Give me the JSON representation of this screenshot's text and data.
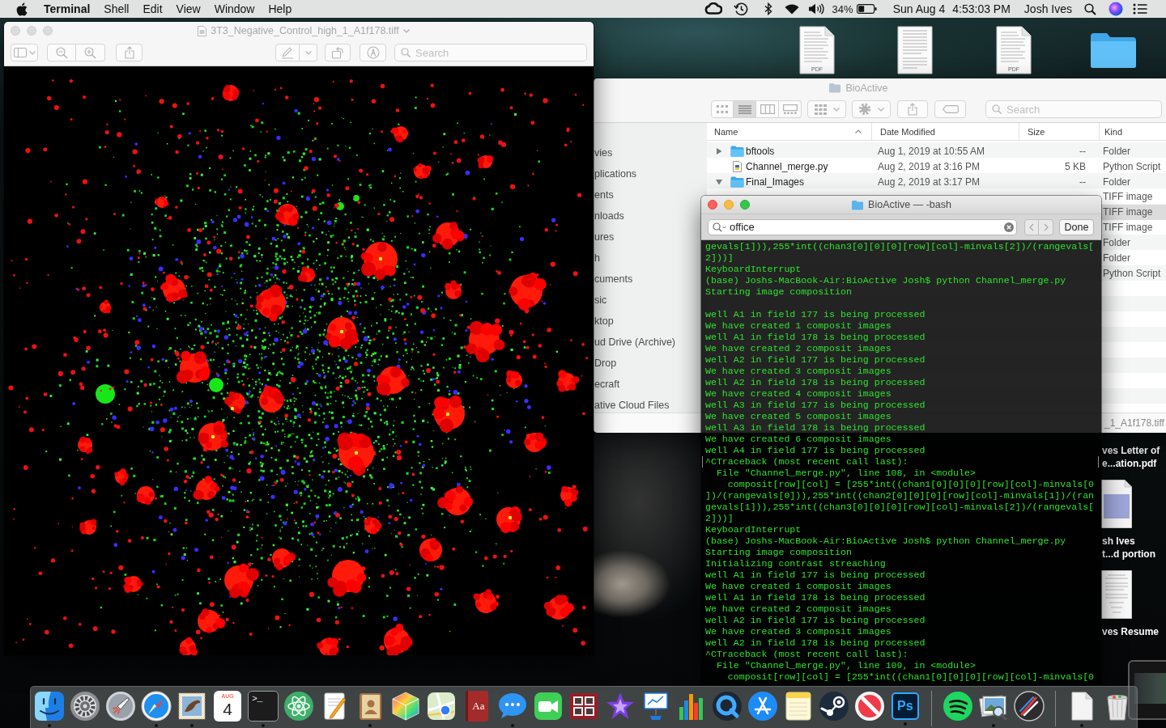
{
  "menu_bar": {
    "app_name": "Terminal",
    "menus": [
      "Shell",
      "Edit",
      "View",
      "Window",
      "Help"
    ],
    "battery": "34%",
    "date": "Sun Aug 4",
    "time": "4:53:03 PM",
    "user": "Josh Ives"
  },
  "desktop_icons": [
    {
      "kind": "pdf",
      "badge": "PDF"
    },
    {
      "kind": "document"
    },
    {
      "kind": "pdf",
      "badge": "PDF"
    },
    {
      "kind": "folder"
    }
  ],
  "preview_window": {
    "active": false,
    "title": "3T3_Negative_Control_high_1_A1f178.tiff",
    "search": {
      "placeholder": "Search"
    }
  },
  "finder_window": {
    "active": false,
    "title": "BioActive",
    "view_modes": [
      {
        "kind": "icons",
        "selected": false
      },
      {
        "kind": "list",
        "selected": true
      },
      {
        "kind": "columns",
        "selected": false
      },
      {
        "kind": "gallery",
        "selected": false
      }
    ],
    "search": {
      "placeholder": "Search"
    },
    "sidebar": {
      "items": [
        "vies",
        "plications",
        "ents",
        "nloads",
        "ures",
        "h",
        "cuments",
        "sic",
        "ktop",
        "ud Drive (Archive)",
        "Drop",
        "ecraft",
        "ative Cloud Files"
      ]
    },
    "columns": [
      {
        "label": "Name",
        "sorted": true
      },
      {
        "label": "Date Modified",
        "sorted": false
      },
      {
        "label": "Size",
        "sorted": false
      },
      {
        "label": "Kind",
        "sorted": false
      }
    ],
    "rows": [
      {
        "kind": "folder",
        "expanded": false,
        "name": "bftools",
        "date_modified": "Aug 1, 2019 at 10:55 AM",
        "size": "--",
        "kind_text": "Folder",
        "selected": false
      },
      {
        "kind": "script",
        "name": "Channel_merge.py",
        "date_modified": "Aug 2, 2019 at 3:16 PM",
        "size": "5 KB",
        "kind_text": "Python Script",
        "selected": false
      },
      {
        "kind": "folder",
        "expanded": true,
        "name": "Final_Images",
        "date_modified": "Aug 2, 2019 at 3:17 PM",
        "size": "--",
        "kind_text": "Folder",
        "selected": false
      },
      {
        "kind": "partial",
        "kind_text": "TIFF image",
        "selected": false
      },
      {
        "kind": "partial",
        "kind_text": "TIFF image",
        "selected": true
      },
      {
        "kind": "partial",
        "kind_text": "TIFF image",
        "selected": false
      },
      {
        "kind": "partial",
        "kind_text": "Folder",
        "selected": false
      },
      {
        "kind": "partial",
        "kind_text": "Folder",
        "selected": false
      },
      {
        "kind": "partial",
        "kind_text": "Python Script",
        "selected": false
      }
    ],
    "path_bar": "_1_A1f178.tiff"
  },
  "terminal_window": {
    "active": true,
    "title": "BioActive — -bash",
    "find_field": {
      "value": "office"
    },
    "done_label": "Done",
    "blocks": [
      {
        "lines": [
          {
            "text": "gevals[1])),255*int((chan3[0][0][0][row][col]-minvals[2])/(rangevals[",
            "marked": false
          },
          {
            "text": "2]))]",
            "marked": false
          },
          {
            "text": "KeyboardInterrupt",
            "marked": false
          },
          {
            "text": "(base) Joshs-MacBook-Air:BioActive Josh$ python Channel_merge.py",
            "marked": false
          },
          {
            "text": "Starting image composition",
            "marked": false
          }
        ]
      },
      {
        "lines": [
          {
            "text": "well A1 in field 177 is being processed",
            "marked": false
          },
          {
            "text": "We have created 1 composit images",
            "marked": false
          },
          {
            "text": "well A1 in field 178 is being processed",
            "marked": false
          },
          {
            "text": "We have created 2 composit images",
            "marked": false
          },
          {
            "text": "well A2 in field 177 is being processed",
            "marked": false
          },
          {
            "text": "We have created 3 composit images",
            "marked": false
          },
          {
            "text": "well A2 in field 178 is being processed",
            "marked": false
          },
          {
            "text": "We have created 4 composit images",
            "marked": false
          },
          {
            "text": "well A3 in field 177 is being processed",
            "marked": false
          },
          {
            "text": "We have created 5 composit images",
            "marked": false
          },
          {
            "text": "well A3 in field 178 is being processed",
            "marked": false
          },
          {
            "text": "We have created 6 composit images",
            "marked": false
          },
          {
            "text": "well A4 in field 177 is being processed",
            "marked": false
          },
          {
            "text": "^CTraceback (most recent call last):",
            "marked": true
          },
          {
            "text": "  File \"Channel_merge.py\", line 108, in <module>",
            "marked": false
          },
          {
            "text": "    composit[row][col] = [255*int((chan1[0][0][0][row][col]-minvals[0",
            "marked": false
          },
          {
            "text": "])/(rangevals[0])),255*int((chan2[0][0][0][row][col]-minvals[1])/(ran",
            "marked": false
          },
          {
            "text": "gevals[1])),255*int((chan3[0][0][0][row][col]-minvals[2])/(rangevals[",
            "marked": false
          },
          {
            "text": "2]))]",
            "marked": false
          },
          {
            "text": "KeyboardInterrupt",
            "marked": false
          },
          {
            "text": "(base) Joshs-MacBook-Air:BioActive Josh$ python Channel_merge.py",
            "marked": false
          },
          {
            "text": "Starting image composition",
            "marked": false
          },
          {
            "text": "Initializing contrast streaching",
            "marked": false
          },
          {
            "text": "well A1 in field 177 is being processed",
            "marked": false
          },
          {
            "text": "We have created 1 composit images",
            "marked": false
          },
          {
            "text": "well A1 in field 178 is being processed",
            "marked": false
          },
          {
            "text": "We have created 2 composit images",
            "marked": false
          },
          {
            "text": "well A2 in field 177 is being processed",
            "marked": false
          },
          {
            "text": "We have created 3 composit images",
            "marked": false
          },
          {
            "text": "well A2 in field 178 is being processed",
            "marked": false
          },
          {
            "text": "^CTraceback (most recent call last):",
            "marked": false
          },
          {
            "text": "  File \"Channel_merge.py\", line 109, in <module>",
            "marked": false
          },
          {
            "text": "    composit[row][col] = [255*int((chan1[0][0][0][row][col]-minvals[0",
            "marked": false
          }
        ]
      }
    ]
  },
  "desktop_files": [
    {
      "kind": "label",
      "lines": [
        "ves Letter of",
        "e...ation.pdf"
      ]
    },
    {
      "kind": "scan"
    },
    {
      "kind": "label",
      "lines": [
        "sh Ives",
        "t...d portion"
      ]
    },
    {
      "kind": "document"
    },
    {
      "kind": "label",
      "lines": [
        "ves Resume"
      ]
    },
    {
      "kind": "screenshot"
    }
  ],
  "dock": {
    "items": [
      {
        "kind": "finder",
        "running": true
      },
      {
        "kind": "settings",
        "running": false
      },
      {
        "kind": "launchpad",
        "running": false
      },
      {
        "kind": "safari",
        "running": true
      },
      {
        "kind": "mail",
        "running": true
      },
      {
        "kind": "calendar",
        "month": "AUG",
        "day": "4",
        "running": false
      },
      {
        "kind": "terminal",
        "glyph": ">_",
        "running": true
      },
      {
        "kind": "atom",
        "running": false
      },
      {
        "kind": "pages",
        "running": false
      },
      {
        "kind": "contacts",
        "running": true
      },
      {
        "kind": "grapher",
        "running": false
      },
      {
        "kind": "maps",
        "running": false
      },
      {
        "kind": "dictionary",
        "glyph": "Aa",
        "running": false
      },
      {
        "kind": "messages",
        "running": true
      },
      {
        "kind": "facetime",
        "running": false
      },
      {
        "kind": "photobooth",
        "running": false
      },
      {
        "kind": "imovie",
        "running": false
      },
      {
        "kind": "keynote",
        "running": false
      },
      {
        "kind": "numbers",
        "running": false
      },
      {
        "kind": "quicktime",
        "running": false
      },
      {
        "kind": "appstore",
        "running": false
      },
      {
        "kind": "notes",
        "running": false
      },
      {
        "kind": "steam",
        "running": false
      },
      {
        "kind": "news",
        "running": false
      },
      {
        "kind": "photoshop",
        "glyph": "Ps",
        "running": true
      },
      {
        "kind": "separator"
      },
      {
        "kind": "spotify",
        "running": false
      },
      {
        "kind": "preview",
        "running": true
      },
      {
        "kind": "brushes",
        "running": false
      },
      {
        "kind": "separator"
      },
      {
        "kind": "stack",
        "running": true
      },
      {
        "kind": "trash",
        "running": false
      }
    ]
  }
}
